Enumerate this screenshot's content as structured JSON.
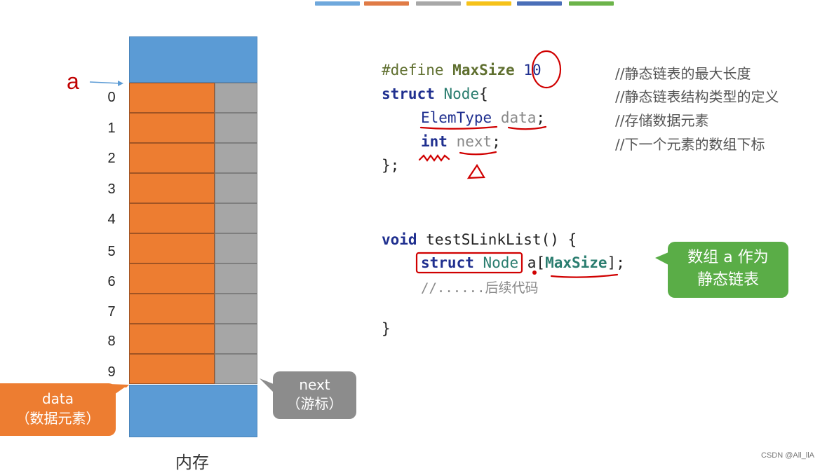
{
  "top_tabs": [
    {
      "color": "#6fa8dc"
    },
    {
      "color": "#e07b46"
    },
    {
      "color": "#a8a8a8"
    },
    {
      "color": "#f6c21a"
    },
    {
      "color": "#4a6fb8"
    },
    {
      "color": "#6cb44a"
    }
  ],
  "memory": {
    "pointer_label": "a",
    "indices": [
      "0",
      "1",
      "2",
      "3",
      "4",
      "5",
      "6",
      "7",
      "8",
      "9"
    ],
    "caption": "内存",
    "colors": {
      "block": "#5b9bd5",
      "data_cell": "#ed7d31",
      "next_cell": "#a6a6a6"
    }
  },
  "callouts": {
    "data": {
      "line1": "data",
      "line2": "（数据元素）",
      "color": "#ed7d31"
    },
    "next": {
      "line1": "next",
      "line2": "（游标）",
      "color": "#8c8c8c"
    },
    "array": {
      "line1": "数组 a 作为",
      "line2": "静态链表",
      "color": "#5aad47"
    }
  },
  "code": {
    "define_kw": "#define",
    "define_name": "MaxSize",
    "define_value": "10",
    "struct_kw": "struct",
    "struct_name": "Node",
    "struct_open": "{",
    "field1_type": "ElemType",
    "field1_name": "data",
    "field2_type": "int",
    "field2_name": "next",
    "semicolon": ";",
    "struct_close": "};",
    "func_void": "void",
    "func_sig": "testSLinkList() {",
    "decl_struct": "struct",
    "decl_node": "Node",
    "decl_a": "a",
    "decl_size": "MaxSize",
    "decl_close": "];",
    "follow_comment": "//......后续代码",
    "func_close": "}"
  },
  "comments": [
    "//静态链表的最大长度",
    "//静态链表结构类型的定义",
    "//存储数据元素",
    "//下一个元素的数组下标"
  ],
  "watermark": "CSDN @All_llA"
}
